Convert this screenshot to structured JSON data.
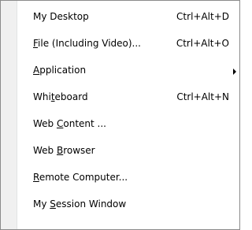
{
  "menu": {
    "items": [
      {
        "name": "my-desktop",
        "pre": "My Desktop",
        "acc": "",
        "post": "",
        "shortcut": "Ctrl+Alt+D",
        "submenu": false
      },
      {
        "name": "file-including-video",
        "pre": "",
        "acc": "F",
        "post": "ile (Including Video)...",
        "shortcut": "Ctrl+Alt+O",
        "submenu": false
      },
      {
        "name": "application",
        "pre": "",
        "acc": "A",
        "post": "pplication",
        "shortcut": "",
        "submenu": true
      },
      {
        "name": "whiteboard",
        "pre": "Whi",
        "acc": "t",
        "post": "eboard",
        "shortcut": "Ctrl+Alt+N",
        "submenu": false
      },
      {
        "name": "web-content",
        "pre": "Web ",
        "acc": "C",
        "post": "ontent ...",
        "shortcut": "",
        "submenu": false
      },
      {
        "name": "web-browser",
        "pre": "Web ",
        "acc": "B",
        "post": "rowser",
        "shortcut": "",
        "submenu": false
      },
      {
        "name": "remote-computer",
        "pre": "",
        "acc": "R",
        "post": "emote Computer...",
        "shortcut": "",
        "submenu": false
      },
      {
        "name": "my-session-window",
        "pre": "My ",
        "acc": "S",
        "post": "ession Window",
        "shortcut": "",
        "submenu": false
      }
    ],
    "submenu_arrow_icon": "triangle-right-icon"
  }
}
